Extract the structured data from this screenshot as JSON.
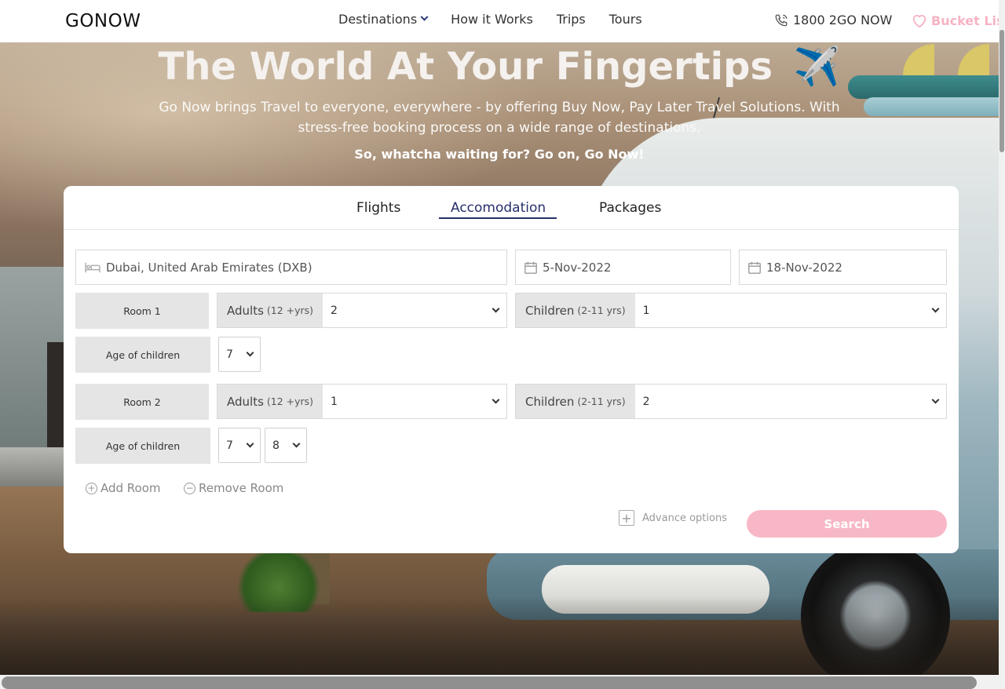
{
  "brand": {
    "logo_text": "GONOW"
  },
  "nav": {
    "links": [
      "Destinations",
      "How it Works",
      "Trips",
      "Tours"
    ],
    "phone": "1800 2GO NOW",
    "bucket_list": "Bucket List"
  },
  "hero": {
    "title": "The World At Your Fingertips",
    "title_emoji": "✈️",
    "subtitle": "Go Now brings Travel to everyone, everywhere - by offering Buy Now, Pay Later Travel Solutions. With stress-free booking process on a wide range of destinations.",
    "cta": "So, whatcha waiting for? Go on, Go Now!"
  },
  "booking": {
    "tabs": [
      "Flights",
      "Accomodation",
      "Packages"
    ],
    "active_tab": "Accomodation",
    "destination": "Dubai, United Arab Emirates (DXB)",
    "check_in": "5-Nov-2022",
    "check_out": "18-Nov-2022",
    "rooms": [
      {
        "label": "Room 1",
        "adults_label": "Adults",
        "adults_hint": "(12 +yrs)",
        "adults": "2",
        "children_label": "Children",
        "children_hint": "(2-11 yrs)",
        "children": "1",
        "ages_label": "Age of children",
        "ages": [
          "7"
        ]
      },
      {
        "label": "Room 2",
        "adults_label": "Adults",
        "adults_hint": "(12 +yrs)",
        "adults": "1",
        "children_label": "Children",
        "children_hint": "(2-11 yrs)",
        "children": "2",
        "ages_label": "Age of children",
        "ages": [
          "7",
          "8"
        ]
      }
    ],
    "add_room": "Add Room",
    "remove_room": "Remove Room",
    "advance_options": "Advance options",
    "search": "Search"
  },
  "colors": {
    "accent": "#26306b",
    "pink": "#f8b7c6",
    "bucket": "#f6b3c3"
  },
  "icons": [
    "chevron-down-icon",
    "phone-icon",
    "heart-icon",
    "bed-icon",
    "calendar-icon",
    "plus-circle-icon",
    "minus-circle-icon",
    "plus-square-icon",
    "airplane-icon"
  ]
}
